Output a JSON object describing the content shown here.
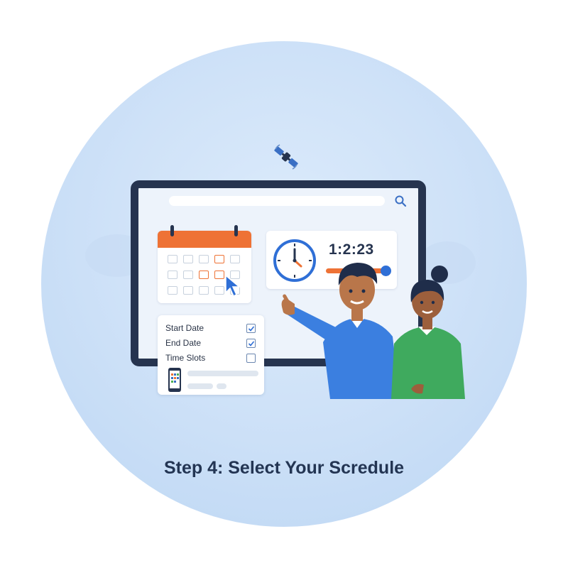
{
  "header": {
    "title": "Step 4: Select Your Scredule"
  },
  "clock": {
    "time": "1:2:23",
    "slider_fraction": 0.9
  },
  "form": {
    "rows": [
      {
        "label": "Start Date",
        "checked": true
      },
      {
        "label": "End Date",
        "checked": true
      },
      {
        "label": "Time Slots",
        "checked": false
      }
    ]
  },
  "colors": {
    "accent": "#ee7235",
    "navy": "#26344f",
    "blue": "#2f6fd6",
    "background": "#cfe2f8"
  },
  "icons": [
    "satellite-icon",
    "search-icon",
    "calendar-icon",
    "cursor-icon",
    "clock-icon",
    "checkbox-icon",
    "phone-icon"
  ]
}
